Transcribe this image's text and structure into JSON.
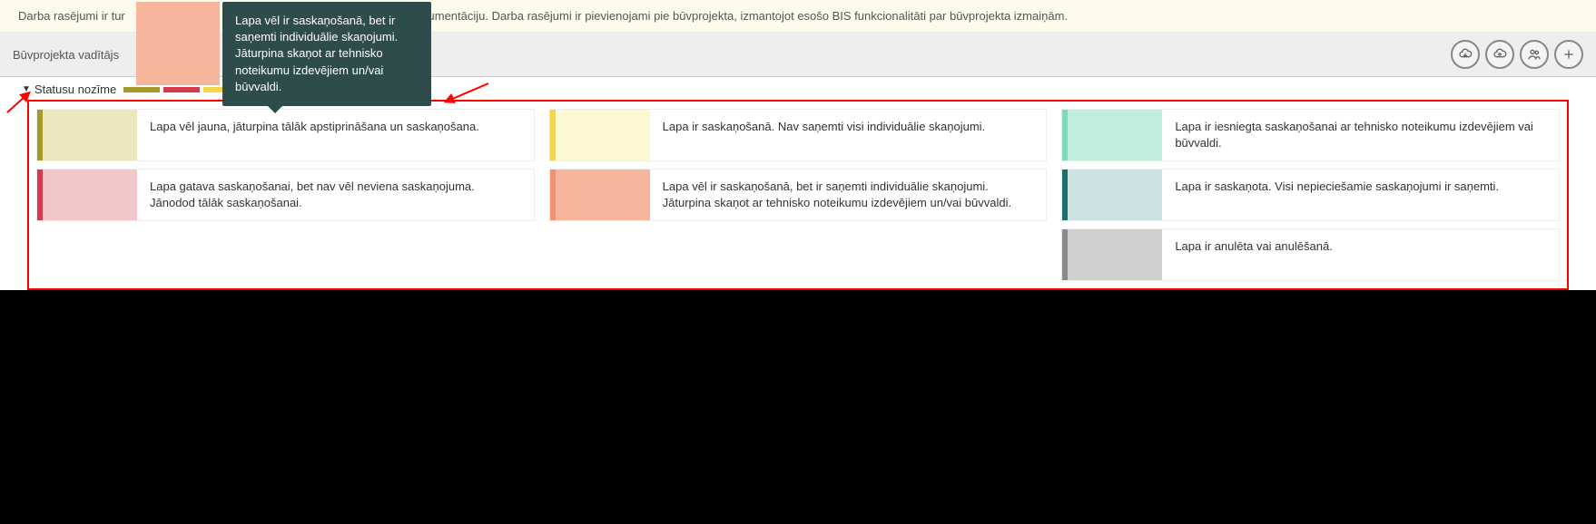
{
  "notice": {
    "text_left": "Darba rasējumi ir tur",
    "text_right": "kumentāciju. Darba rasējumi ir pievienojami pie būvprojekta, izmantojot esošo BIS funkcionalitāti par būvprojekta izmaiņām."
  },
  "toolbar": {
    "left_label": "Būvprojekta vadītājs"
  },
  "legend_header": {
    "title": "Statusu nozīme"
  },
  "tooltip": {
    "text": "Lapa vēl ir saskaņošanā, bet ir saņemti individuālie skaņojumi. Jāturpina skaņot ar tehnisko noteikumu izdevējiem un/vai būvvaldi."
  },
  "legend": {
    "cards": [
      {
        "swatch": "sw-olive",
        "text": "Lapa vēl jauna, jāturpina tālāk apstiprināšana un saskaņošana."
      },
      {
        "swatch": "sw-pink",
        "text": "Lapa gatava saskaņošanai, bet nav vēl neviena saskaņojuma. Jānodod tālāk saskaņošanai."
      },
      {
        "swatch": "sw-yellow",
        "text": "Lapa ir saskaņošanā. Nav saņemti visi individuālie skaņojumi."
      },
      {
        "swatch": "sw-salmon",
        "text": "Lapa vēl ir saskaņošanā, bet ir saņemti individuālie skaņojumi. Jāturpina skaņot ar tehnisko noteikumu izdevējiem un/vai būvvaldi."
      },
      {
        "swatch": "sw-mint",
        "text": "Lapa ir iesniegta saskaņošanai ar tehnisko noteikumu izdevējiem vai būvvaldi."
      },
      {
        "swatch": "sw-teal",
        "text": "Lapa ir saskaņota. Visi nepieciešamie saskaņojumi ir saņemti."
      },
      {
        "swatch": "sw-gray",
        "text": "Lapa ir anulēta vai anulēšanā."
      }
    ]
  },
  "strip_colors": [
    "#a39a2a",
    "#d9394f",
    "#f2d648",
    "#f0936f",
    "#bfeedd",
    "#1e6e6e",
    "#8a8a8a"
  ]
}
